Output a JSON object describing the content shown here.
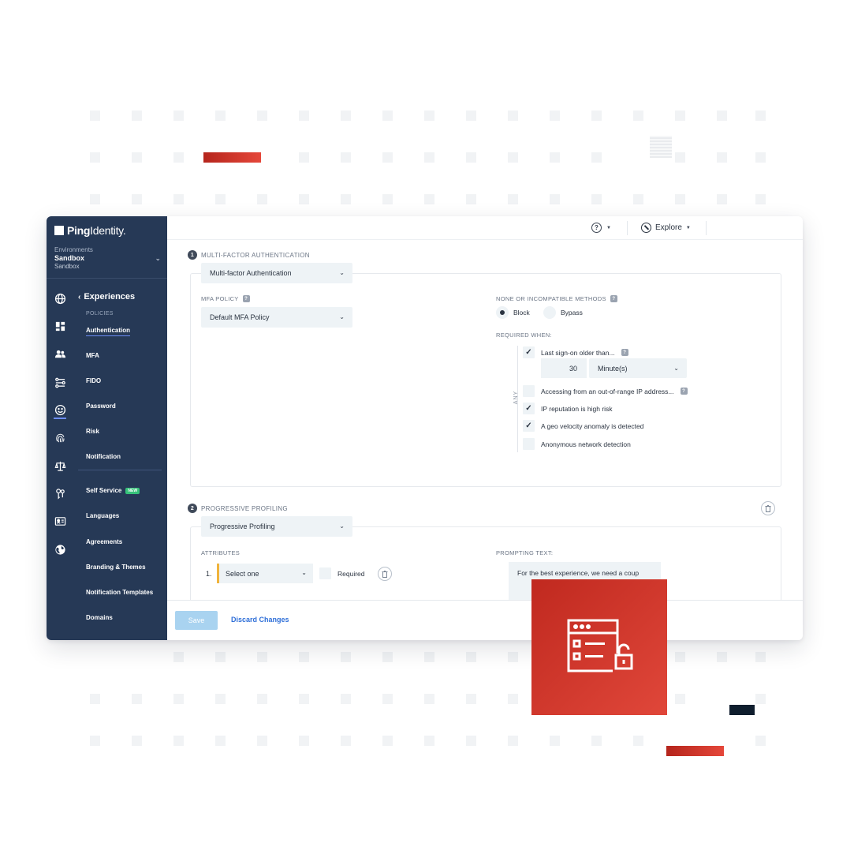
{
  "brand": {
    "name_bold": "Ping",
    "name_light": "Identity.",
    "accent": "#d23a2e",
    "sidebar_bg": "#263956"
  },
  "environment": {
    "label": "Environments",
    "name": "Sandbox",
    "sub": "Sandbox"
  },
  "rail_icons": [
    "globe-icon",
    "dashboard-icon",
    "users-icon",
    "connections-icon",
    "experiences-icon",
    "fingerprint-icon",
    "scales-icon",
    "keys-icon",
    "id-card-icon",
    "world-icon"
  ],
  "nav": {
    "back_label": "Experiences",
    "section": "POLICIES",
    "items": [
      "Authentication",
      "MFA",
      "FIDO",
      "Password",
      "Risk",
      "Notification"
    ],
    "items2": [
      "Self Service",
      "Languages",
      "Agreements",
      "Branding & Themes",
      "Notification Templates",
      "Domains"
    ],
    "new_badge": "NEW"
  },
  "topbar": {
    "help": "?",
    "explore": "Explore"
  },
  "mfa": {
    "step_number": "1",
    "step_title": "MULTI-FACTOR AUTHENTICATION",
    "type_value": "Multi-factor Authentication",
    "policy_label": "MFA POLICY",
    "policy_value": "Default MFA Policy",
    "incompatible_label": "NONE OR INCOMPATIBLE METHODS",
    "option_block": "Block",
    "option_bypass": "Bypass",
    "selected_option": "Block",
    "required_when_label": "REQUIRED WHEN:",
    "any_label": "ANY",
    "conditions": [
      {
        "label": "Last sign-on older than...",
        "checked": true
      },
      {
        "label": "Accessing from an out-of-range IP address...",
        "checked": false
      },
      {
        "label": "IP reputation is high risk",
        "checked": true
      },
      {
        "label": "A geo velocity anomaly is detected",
        "checked": true
      },
      {
        "label": "Anonymous network detection",
        "checked": false
      }
    ],
    "duration_value": "30",
    "duration_unit": "Minute(s)"
  },
  "profiling": {
    "step_number": "2",
    "step_title": "PROGRESSIVE PROFILING",
    "type_value": "Progressive Profiling",
    "attributes_label": "ATTRIBUTES",
    "prompting_label": "PROMPTING TEXT:",
    "attr_index": "1.",
    "attr_value": "Select one",
    "required_label": "Required",
    "prompt_text": "For the best experience, we need a coup"
  },
  "footer": {
    "save": "Save",
    "discard": "Discard Changes"
  }
}
